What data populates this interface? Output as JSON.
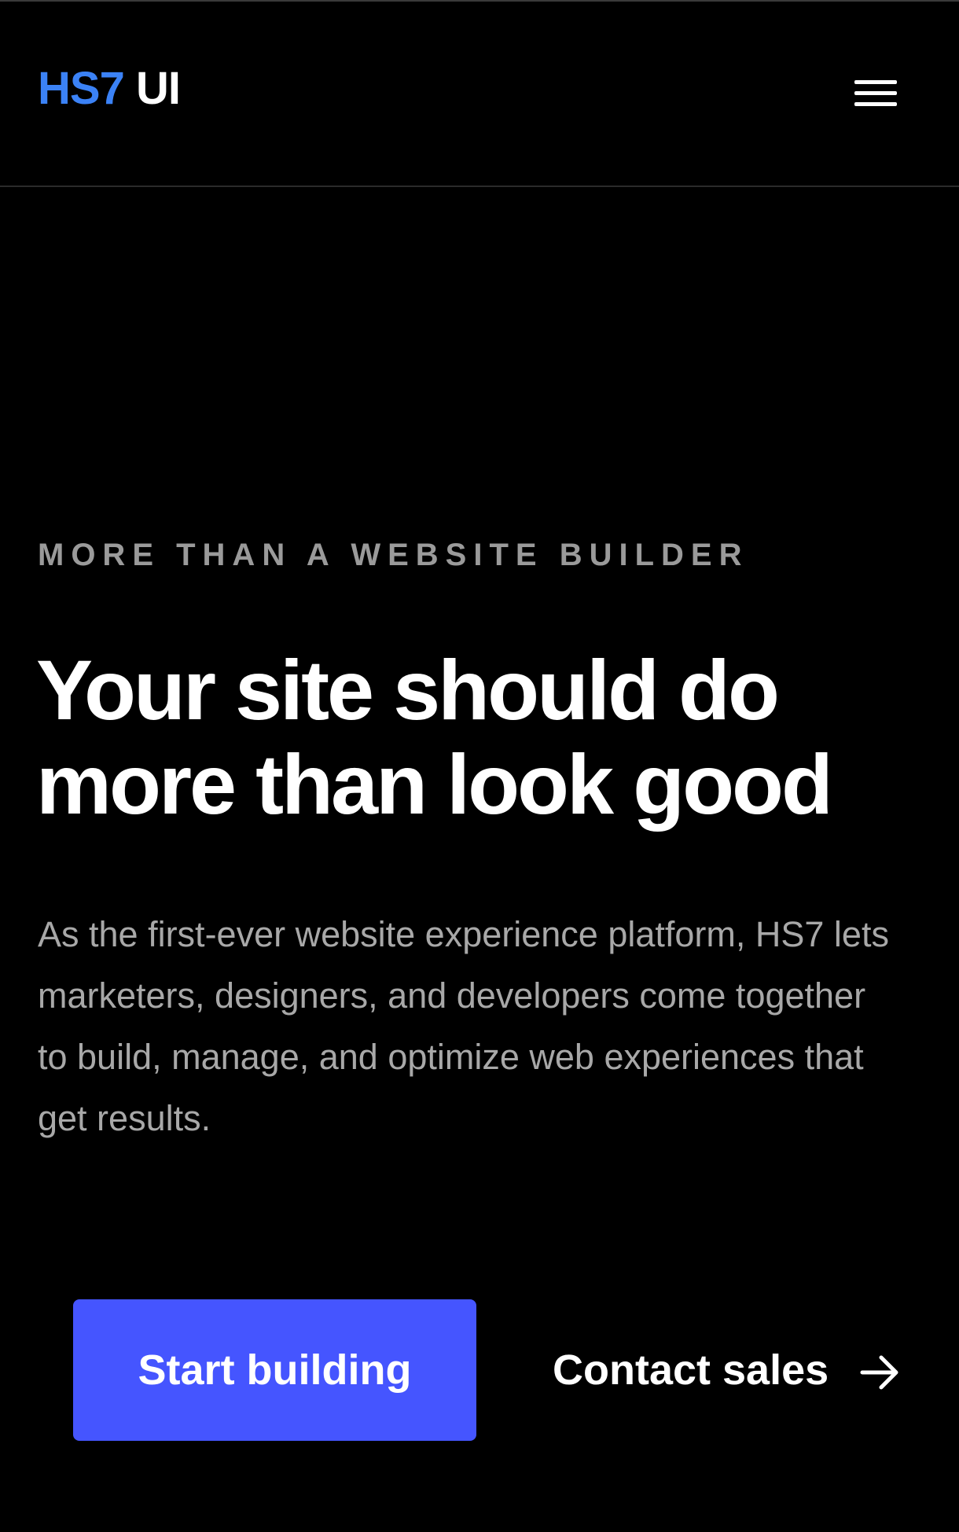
{
  "header": {
    "logo_brand": "HS7",
    "logo_suffix": "UI",
    "menu_icon": "hamburger-menu-icon"
  },
  "hero": {
    "eyebrow": "MORE THAN A WEBSITE BUILDER",
    "headline": "Your site should do more than look good",
    "description": "As the first-ever website experience platform, HS7 lets marketers, designers, and developers come together to build, manage, and optimize web experiences that get results.",
    "primary_button_label": "Start building",
    "secondary_link_label": "Contact sales",
    "secondary_link_icon": "arrow-right-icon"
  },
  "colors": {
    "background": "#000000",
    "brand_blue": "#3b82f6",
    "primary_button": "#4555ff",
    "muted_text": "#a8a8a8"
  }
}
